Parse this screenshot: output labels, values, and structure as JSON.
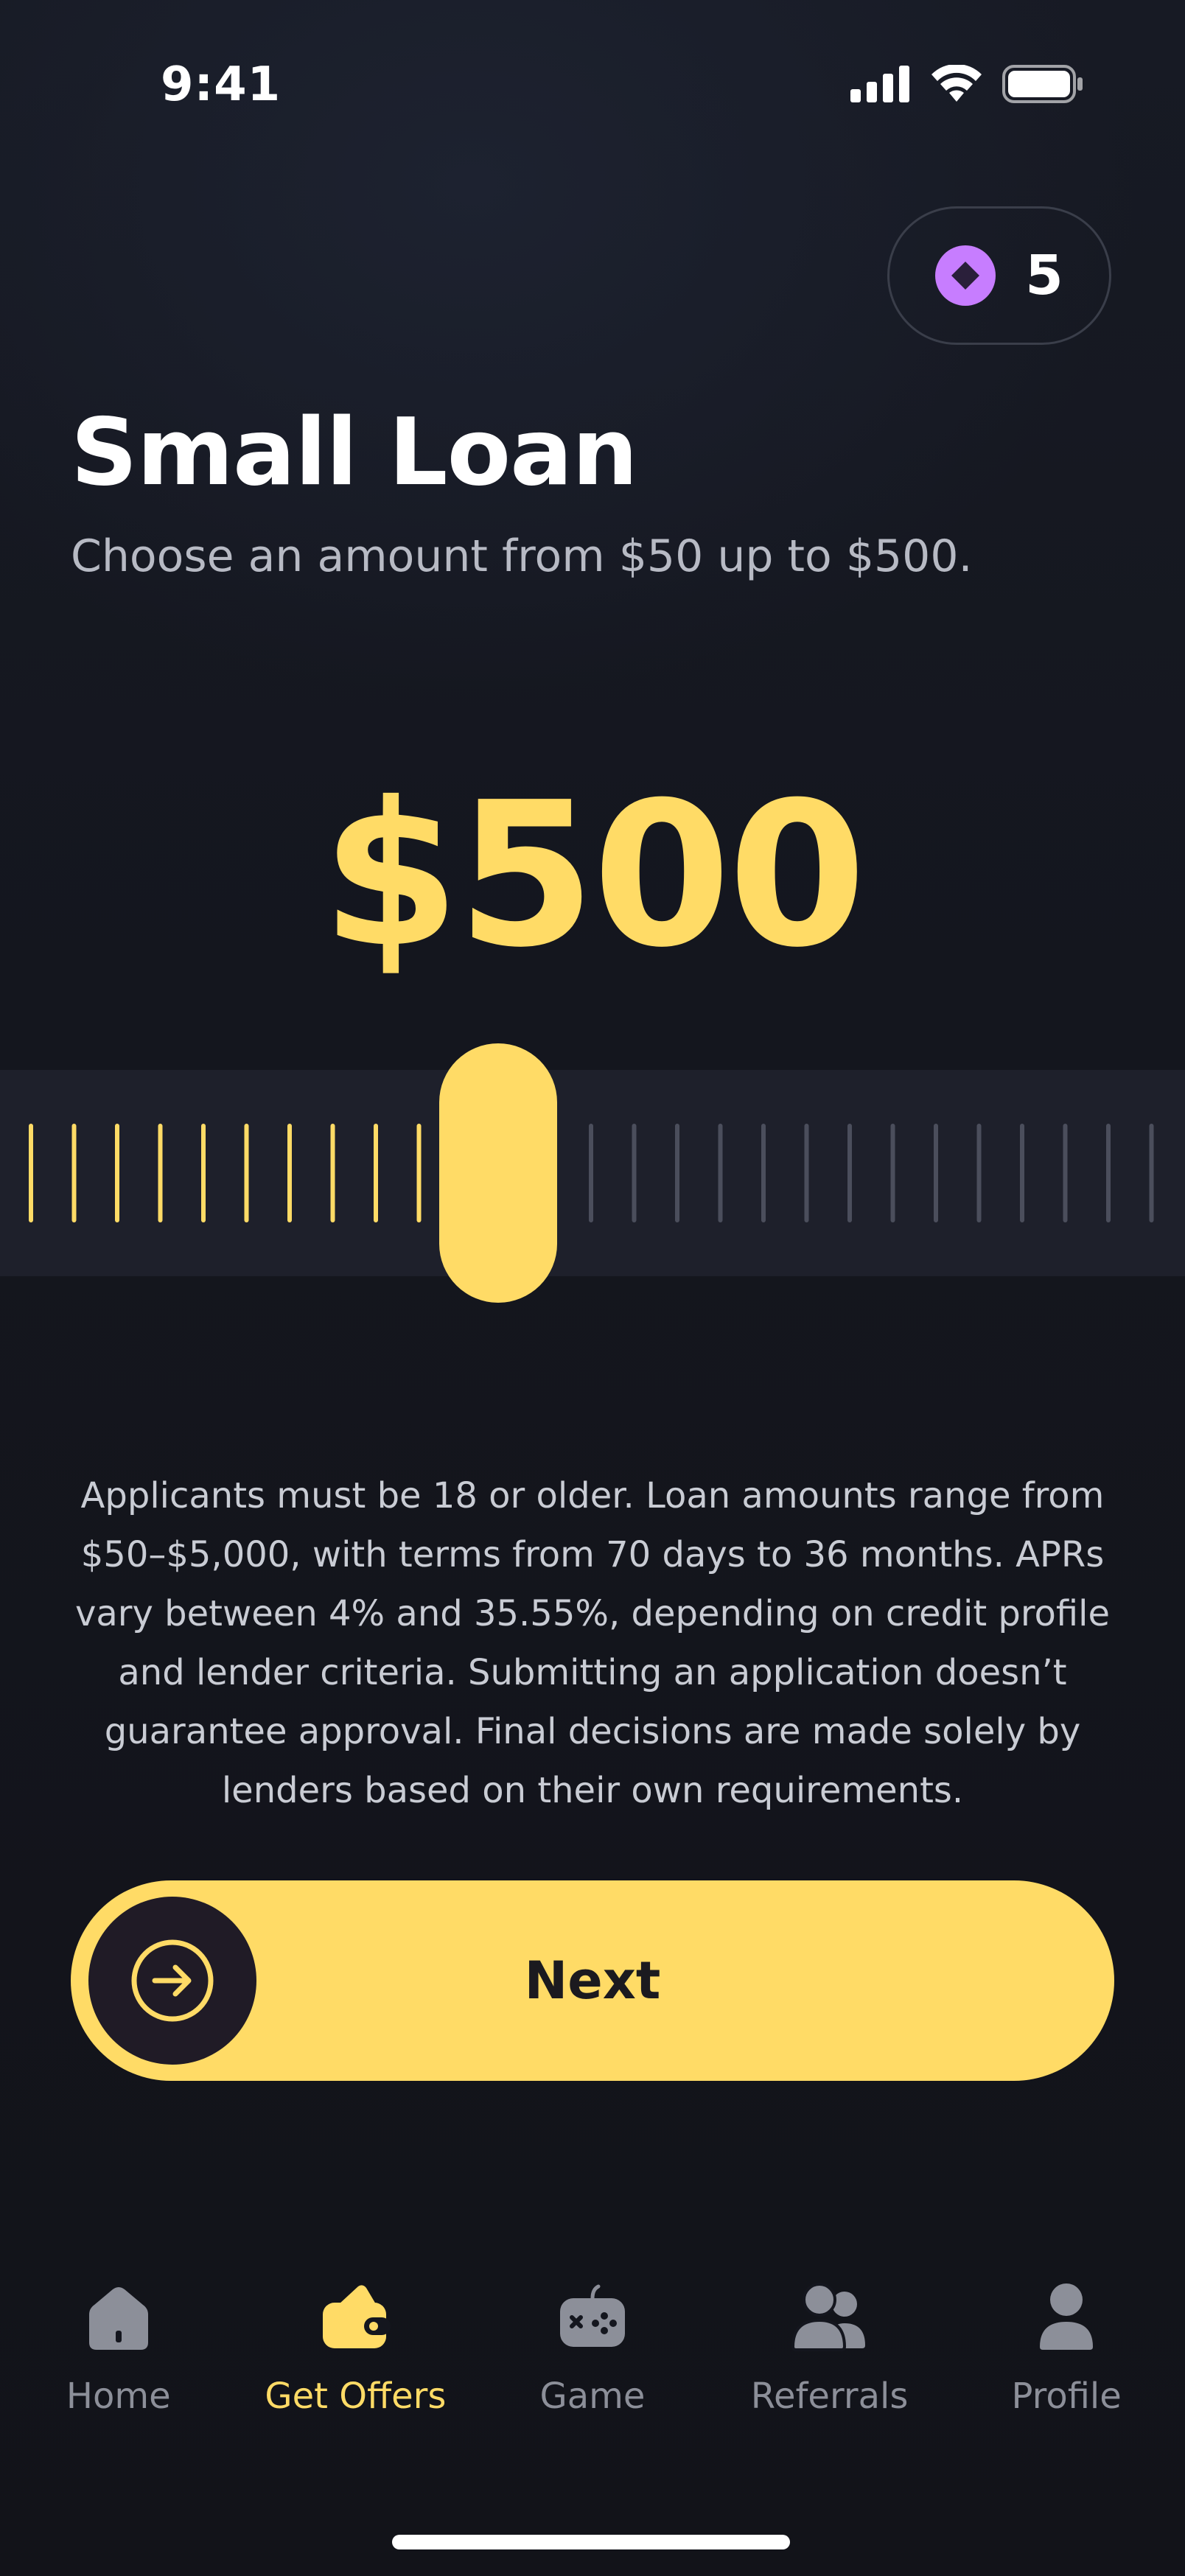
{
  "status_bar": {
    "time": "9:41"
  },
  "badge": {
    "value": "5",
    "icon": "diamond-gem-icon",
    "color": "#c77dff"
  },
  "header": {
    "title": "Small Loan",
    "subtitle": "Choose an amount from $50 up to $500."
  },
  "amount": {
    "display": "$500"
  },
  "slider": {
    "level": 0.29,
    "filled_ticks": 10,
    "empty_ticks": 14,
    "fill_color": "#ffdb66",
    "empty_color": "#4b4e5c"
  },
  "disclaimer": {
    "lines": [
      "Applicants must be 18 or older. Loan amounts range from",
      "$50–$5,000, with terms from 70 days to 36 months. APRs",
      "vary between 4% and 35.55%, depending on credit profile",
      "and lender criteria. Submitting an application doesn’t",
      "guarantee approval. Final decisions are made solely by",
      "lenders based on their own requirements."
    ]
  },
  "next_button": {
    "label": "Next",
    "icon": "arrow-right-circle-icon"
  },
  "bottom_nav": {
    "items": [
      {
        "label": "Home",
        "icon": "home-icon",
        "active": false
      },
      {
        "label": "Get Offers",
        "icon": "wallet-icon",
        "active": true
      },
      {
        "label": "Game",
        "icon": "gamepad-icon",
        "active": false
      },
      {
        "label": "Referrals",
        "icon": "users-icon",
        "active": false
      },
      {
        "label": "Profile",
        "icon": "user-icon",
        "active": false
      }
    ]
  },
  "colors": {
    "accent": "#ffdb66",
    "background": "#121319",
    "muted": "#8c8f99"
  }
}
